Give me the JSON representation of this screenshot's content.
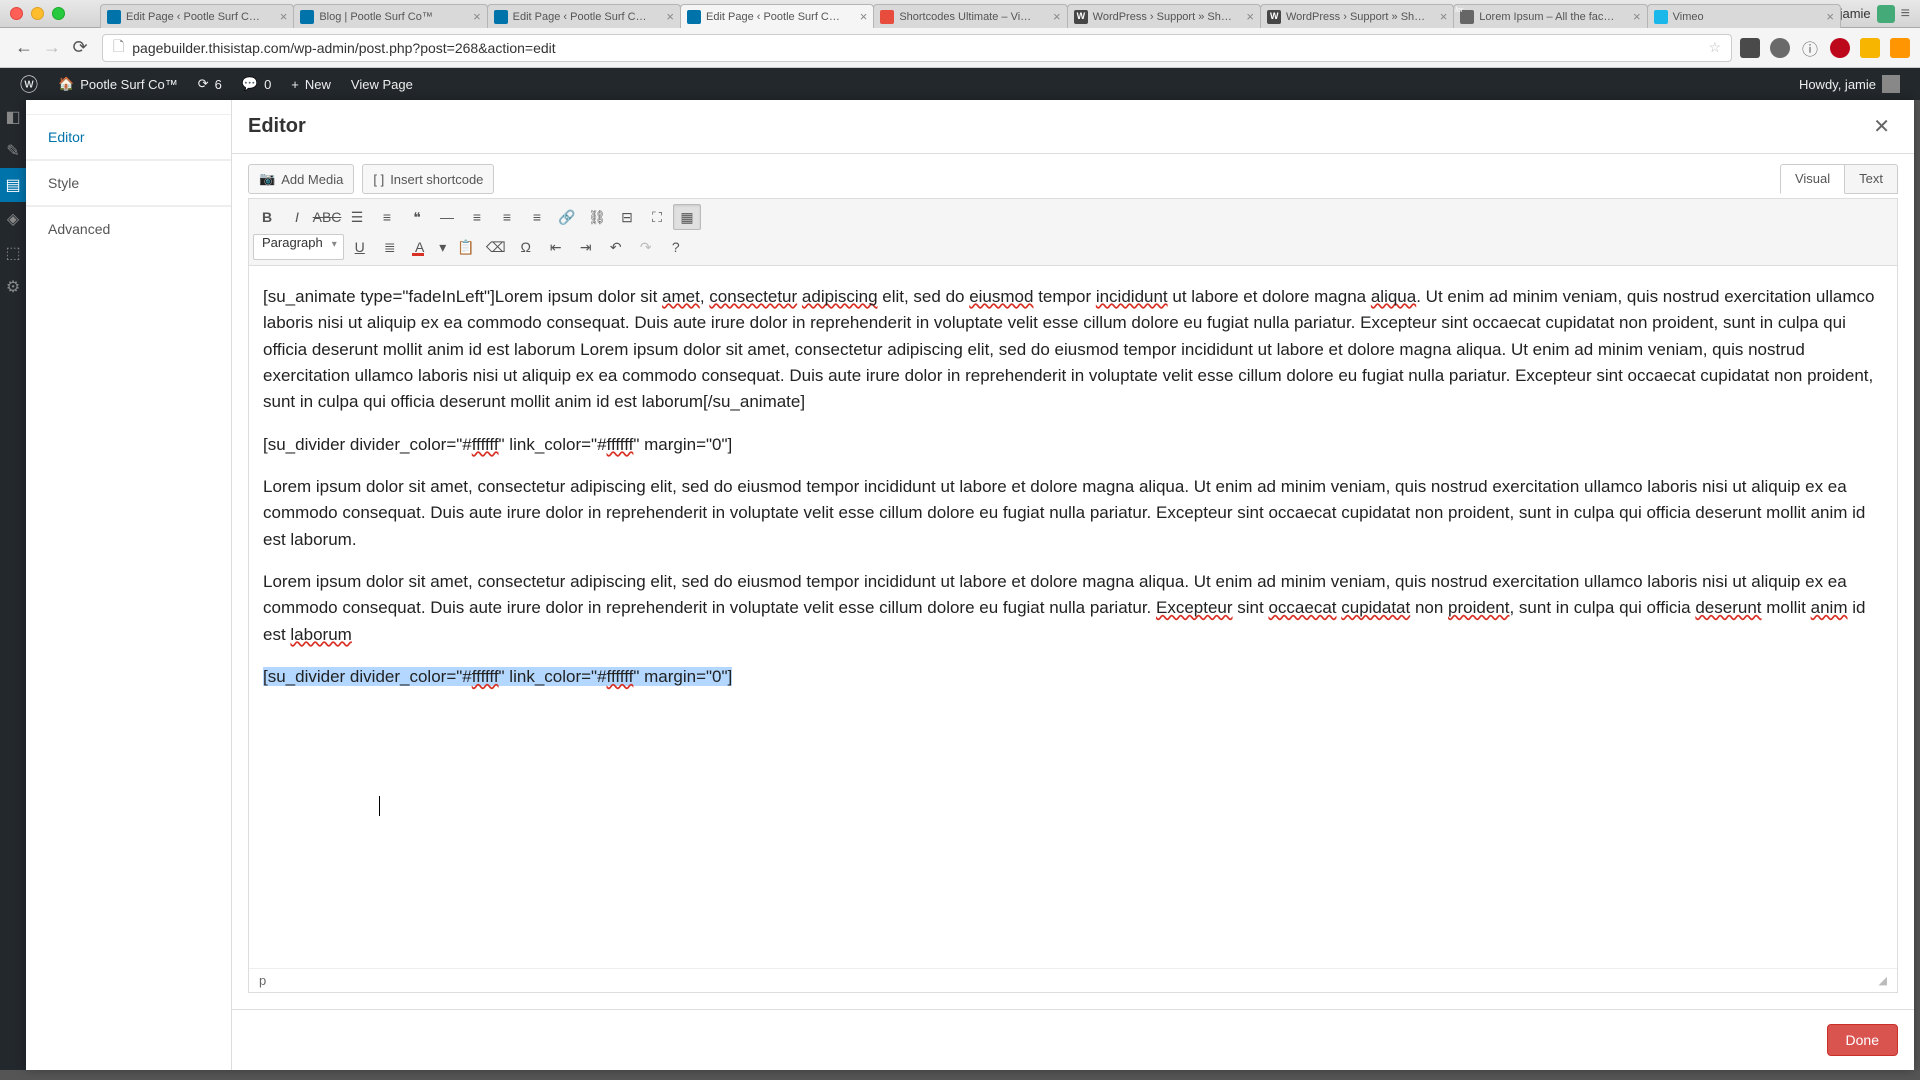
{
  "mac": {
    "user": "jamie"
  },
  "browser": {
    "tabs": [
      {
        "label": "Edit Page ‹ Pootle Surf C…",
        "fav": "pootle"
      },
      {
        "label": "Blog | Pootle Surf Co™",
        "fav": "pootle"
      },
      {
        "label": "Edit Page ‹ Pootle Surf C…",
        "fav": "pootle"
      },
      {
        "label": "Edit Page ‹ Pootle Surf C…",
        "fav": "pootle",
        "active": true
      },
      {
        "label": "Shortcodes Ultimate – Vi…",
        "fav": "su"
      },
      {
        "label": "WordPress › Support » Sh…",
        "fav": "wp"
      },
      {
        "label": "WordPress › Support » Sh…",
        "fav": "wp"
      },
      {
        "label": "Lorem Ipsum – All the fac…",
        "fav": "li"
      },
      {
        "label": "Vimeo",
        "fav": "vimeo"
      }
    ],
    "url": "pagebuilder.thisistap.com/wp-admin/post.php?post=268&action=edit"
  },
  "adminbar": {
    "site": "Pootle Surf Co™",
    "updates": "6",
    "comments": "0",
    "new": "New",
    "view": "View Page",
    "howdy": "Howdy, jamie"
  },
  "sidebar": {
    "title": "Editor",
    "items": [
      {
        "label": "Editor",
        "active": false
      },
      {
        "label": "Style",
        "active": false
      },
      {
        "label": "Advanced",
        "active": false
      }
    ]
  },
  "editor": {
    "heading": "Editor",
    "add_media": "Add Media",
    "insert_shortcode": "Insert shortcode",
    "tab_visual": "Visual",
    "tab_text": "Text",
    "format_select": "Paragraph",
    "status_path": "p",
    "done": "Done",
    "content": {
      "p1_pre": "[su_animate type=\"fadeInLeft\"]Lorem ipsum dolor sit ",
      "p1_amet": "amet",
      "p1_a": ", ",
      "p1_cons": "consectetur",
      "p1_sp1": " ",
      "p1_adip": "adipiscing",
      "p1_b": " elit, sed do ",
      "p1_eius": "eiusmod",
      "p1_c": " tempor ",
      "p1_incid": "incididunt",
      "p1_d": " ut labore et dolore magna ",
      "p1_aliqua": "aliqua",
      "p1_rest": ". Ut enim ad minim veniam, quis nostrud exercitation ullamco laboris nisi ut aliquip ex ea commodo consequat. Duis aute irure dolor in reprehenderit in voluptate velit esse cillum dolore eu fugiat nulla pariatur. Excepteur sint occaecat cupidatat non proident, sunt in culpa qui officia deserunt mollit anim id est laborum Lorem ipsum dolor sit amet, consectetur adipiscing elit, sed do eiusmod tempor incididunt ut labore et dolore magna aliqua. Ut enim ad minim veniam, quis nostrud exercitation ullamco laboris nisi ut aliquip ex ea commodo consequat. Duis aute irure dolor in reprehenderit in voluptate velit esse cillum dolore eu fugiat nulla pariatur. Excepteur sint occaecat cupidatat non proident, sunt in culpa qui officia deserunt mollit anim id est laborum[/su_animate]",
      "p2_pre": "[su_divider divider_color=\"#",
      "p2_ff1": "ffffff",
      "p2_mid": "\" link_color=\"#",
      "p2_ff2": "ffffff",
      "p2_post": "\" margin=\"0\"]",
      "p3": "Lorem ipsum dolor sit amet, consectetur adipiscing elit, sed do eiusmod tempor incididunt ut labore et dolore magna aliqua. Ut enim ad minim veniam, quis nostrud exercitation ullamco laboris nisi ut aliquip ex ea commodo consequat. Duis aute irure dolor in reprehenderit in voluptate velit esse cillum dolore eu fugiat nulla pariatur. Excepteur sint occaecat cupidatat non proident, sunt in culpa qui officia deserunt mollit anim id est laborum.",
      "p4_a": "Lorem ipsum dolor sit amet, consectetur adipiscing elit, sed do eiusmod tempor incididunt ut labore et dolore magna aliqua. Ut enim ad minim veniam, quis nostrud exercitation ullamco laboris nisi ut aliquip ex ea commodo consequat. Duis aute irure dolor in reprehenderit in voluptate velit esse cillum dolore eu fugiat nulla pariatur. ",
      "p4_exc": "Excepteur",
      "p4_b": " sint ",
      "p4_occ": "occaecat",
      "p4_sp": " ",
      "p4_cup": "cupidatat",
      "p4_c": " non ",
      "p4_pro": "proident",
      "p4_d": ", sunt in culpa qui officia ",
      "p4_des": "deserunt",
      "p4_e": " mollit ",
      "p4_anim": "anim",
      "p4_f": " id est ",
      "p4_lab": "laborum",
      "p5_pre": "[su_divider divider_color=\"#",
      "p5_ff1": "ffffff",
      "p5_mid": "\" link_color=\"#",
      "p5_ff2": "ffffff",
      "p5_post": "\" margin=\"0\"]"
    }
  }
}
